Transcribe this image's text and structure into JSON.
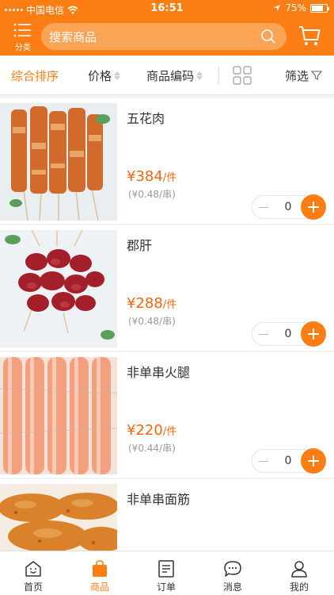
{
  "status_bar": {
    "carrier": "中国电信",
    "time": "16:51",
    "battery": "75%",
    "battery_level": 0.75
  },
  "header": {
    "category_label": "分类",
    "search_placeholder": "搜索商品",
    "icons": {
      "category": "list-icon",
      "search": "search-icon",
      "cart": "cart-icon"
    }
  },
  "sort": {
    "comprehensive": "综合排序",
    "price": "价格",
    "code": "商品编码",
    "filter": "筛选"
  },
  "products": [
    {
      "name": "五花肉",
      "price": "¥384",
      "unit": "/件",
      "sub": "(¥0.48/串)",
      "qty": "0"
    },
    {
      "name": "郡肝",
      "price": "¥288",
      "unit": "/件",
      "sub": "(¥0.48/串)",
      "qty": "0"
    },
    {
      "name": "非单串火腿",
      "price": "¥220",
      "unit": "/件",
      "sub": "(¥0.44/串)",
      "qty": "0"
    },
    {
      "name": "非单串面筋",
      "price": "",
      "unit": "",
      "sub": "",
      "qty": ""
    }
  ],
  "tabbar": [
    {
      "label": "首页",
      "icon": "home-icon"
    },
    {
      "label": "商品",
      "icon": "bag-icon",
      "active": true
    },
    {
      "label": "订单",
      "icon": "order-icon"
    },
    {
      "label": "消息",
      "icon": "message-icon"
    },
    {
      "label": "我的",
      "icon": "profile-icon"
    }
  ],
  "colors": {
    "accent": "#fb7d14",
    "price": "#f2660f"
  }
}
